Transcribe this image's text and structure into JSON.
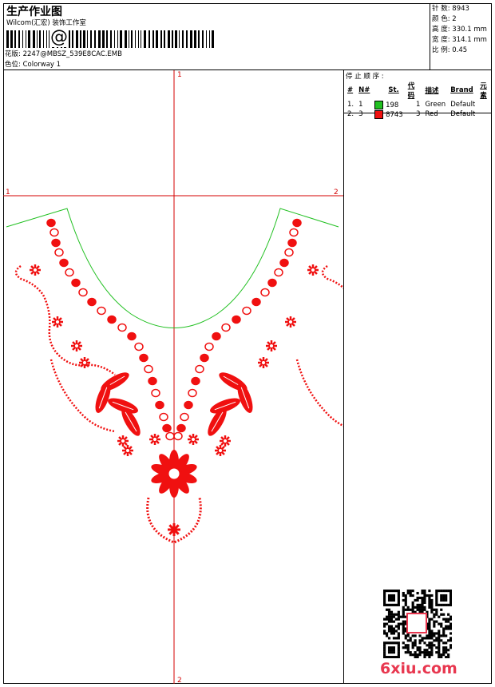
{
  "header": {
    "title": "生产作业图",
    "company": "Wilcom(汇宏) 装饰工作室",
    "barcode_glyph": "@",
    "design_file_label": "花版:",
    "design_file": "2247@MBSZ_539E8CAC.EMB",
    "colorway_label": "色位:",
    "colorway": "Colorway 1"
  },
  "stats": [
    {
      "label": "针 数:",
      "value": "8943"
    },
    {
      "label": "颜 色:",
      "value": "2"
    },
    {
      "label": "高 度:",
      "value": "330.1 mm"
    },
    {
      "label": "宽 度:",
      "value": "314.1 mm"
    },
    {
      "label": "比 例:",
      "value": "0.45"
    }
  ],
  "thread_table": {
    "heading": "停 止 顺 序 :",
    "columns": [
      "#",
      "N#",
      "St.",
      "代码",
      "描述",
      "Brand",
      "元素"
    ],
    "rows": [
      {
        "num": "1.",
        "n": "1",
        "color": "#21c021",
        "stitches": "198",
        "code": "1",
        "desc": "Green",
        "brand": "Default",
        "element": ""
      },
      {
        "num": "2.",
        "n": "3",
        "color": "#f01010",
        "stitches": "8743",
        "code": "3",
        "desc": "Red",
        "brand": "Default",
        "element": ""
      }
    ]
  },
  "crosshair": {
    "top": "1",
    "left": "1",
    "right": "2",
    "bottom": "2"
  },
  "design_colors": {
    "outline": "#21c021",
    "embroidery": "#f01010",
    "axis": "#d40000"
  },
  "watermark": {
    "text": "6xiu.com",
    "color": "#e8374f"
  }
}
